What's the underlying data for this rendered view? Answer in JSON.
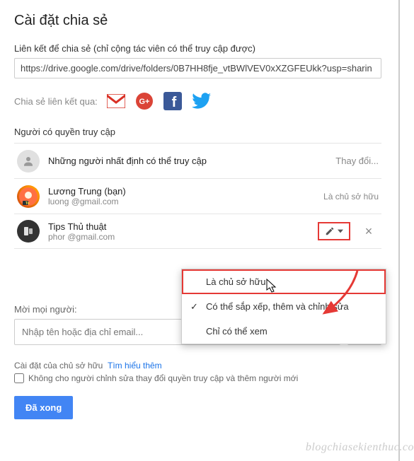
{
  "title": "Cài đặt chia sẻ",
  "link": {
    "label": "Liên kết để chia sẻ (chỉ cộng tác viên có thể truy cập được)",
    "value": "https://drive.google.com/drive/folders/0B7HH8fje_vtBWlVEV0xXZGFEUkk?usp=sharin"
  },
  "share_via": {
    "label": "Chia sẻ liên kết qua:",
    "icons": [
      "gmail",
      "google-plus",
      "facebook",
      "twitter"
    ]
  },
  "access": {
    "header": "Người có quyền truy cập",
    "rows": [
      {
        "type": "summary",
        "text": "Những người nhất định có thể truy cập",
        "action": "Thay đổi..."
      },
      {
        "type": "owner",
        "name": "Lương Trung (bạn)",
        "email": "luong            @gmail.com",
        "role": "Là chủ sở hữu"
      },
      {
        "type": "user",
        "name": "Tips Thủ thuật",
        "email": "phor                  @gmail.com",
        "perm_icon": "pencil"
      }
    ]
  },
  "dropdown": {
    "items": [
      {
        "label": "Là chủ sở hữu",
        "highlighted": true,
        "selected": false
      },
      {
        "label": "Có thể sắp xếp, thêm và chỉnh sửa",
        "highlighted": false,
        "selected": true
      },
      {
        "label": "Chỉ có thể xem",
        "highlighted": false,
        "selected": false
      }
    ]
  },
  "invite": {
    "label": "Mời mọi người:",
    "placeholder": "Nhập tên hoặc địa chỉ email..."
  },
  "owner_settings": {
    "text": "Cài đặt của chủ sở hữu",
    "link": "Tìm hiểu thêm",
    "checkbox": "Không cho người chỉnh sửa thay đổi quyền truy cập và thêm người mới"
  },
  "done": "Đã xong",
  "watermark": "blogchiasekienthuc.co"
}
